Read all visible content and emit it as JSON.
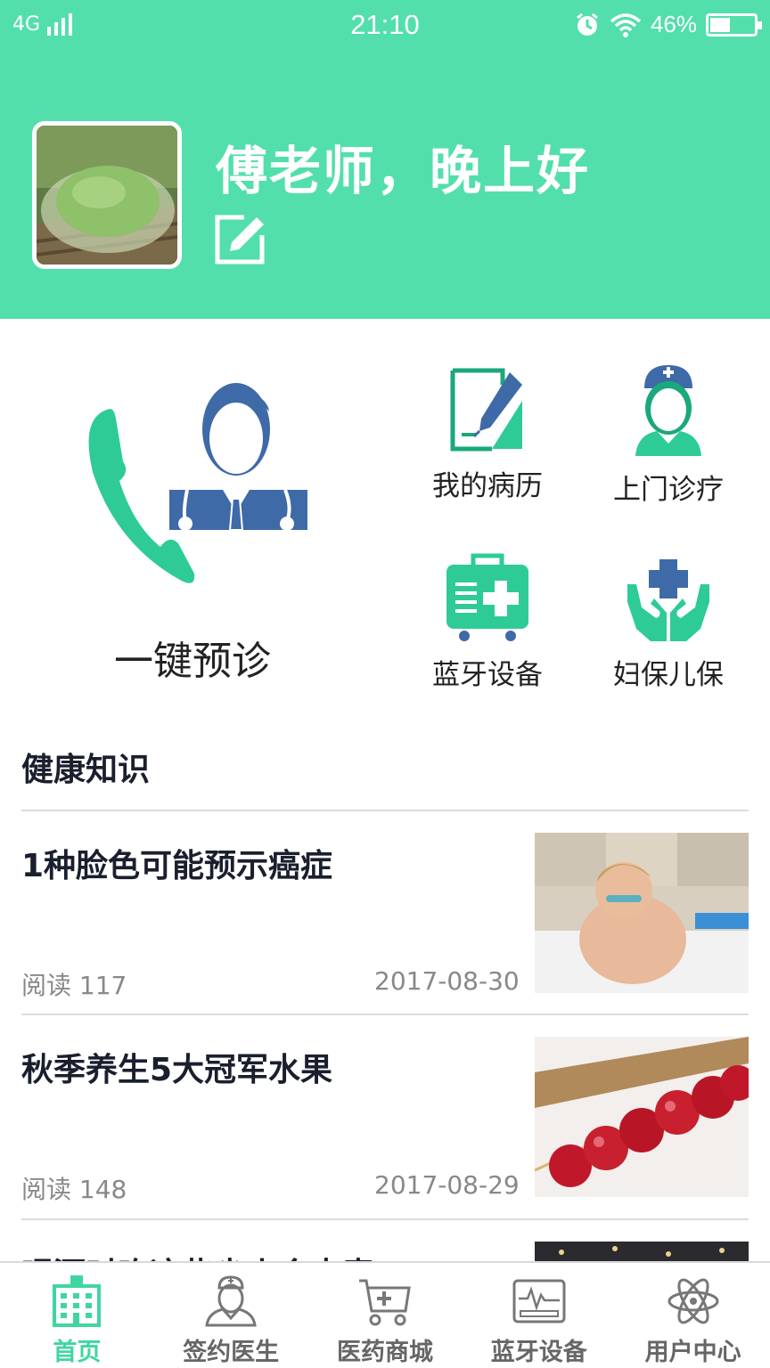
{
  "status_bar": {
    "network": "4G",
    "time": "21:10",
    "battery": "46%",
    "battery_level": 0.46
  },
  "profile": {
    "greeting": "傅老师，晚上好"
  },
  "quick_actions": {
    "main": {
      "label": "一键预诊",
      "icon": "phone-doctor-icon"
    },
    "items": [
      {
        "label": "我的病历",
        "icon": "medical-record-icon"
      },
      {
        "label": "上门诊疗",
        "icon": "nurse-icon"
      },
      {
        "label": "蓝牙设备",
        "icon": "medical-kit-icon"
      },
      {
        "label": "妇保儿保",
        "icon": "hands-cross-icon"
      }
    ]
  },
  "health_knowledge": {
    "title": "健康知识",
    "articles": [
      {
        "title": "1种脸色可能预示癌症",
        "reads": "阅读 117",
        "date": "2017-08-30"
      },
      {
        "title": "秋季养生5大冠军水果",
        "reads": "阅读 148",
        "date": "2017-08-29"
      },
      {
        "title": "喝酒时吃这些尖火会中毒",
        "reads": "",
        "date": ""
      }
    ]
  },
  "colors": {
    "brand": "#52dfab",
    "accent_active": "#3fd6a0",
    "doctor_blue": "#3f6aa8"
  },
  "bottom_nav": [
    {
      "label": "首页",
      "icon": "hospital-icon",
      "active": true
    },
    {
      "label": "签约医生",
      "icon": "doctor-icon",
      "active": false
    },
    {
      "label": "医药商城",
      "icon": "cart-icon",
      "active": false
    },
    {
      "label": "蓝牙设备",
      "icon": "monitor-icon",
      "active": false
    },
    {
      "label": "用户中心",
      "icon": "atom-icon",
      "active": false
    }
  ]
}
